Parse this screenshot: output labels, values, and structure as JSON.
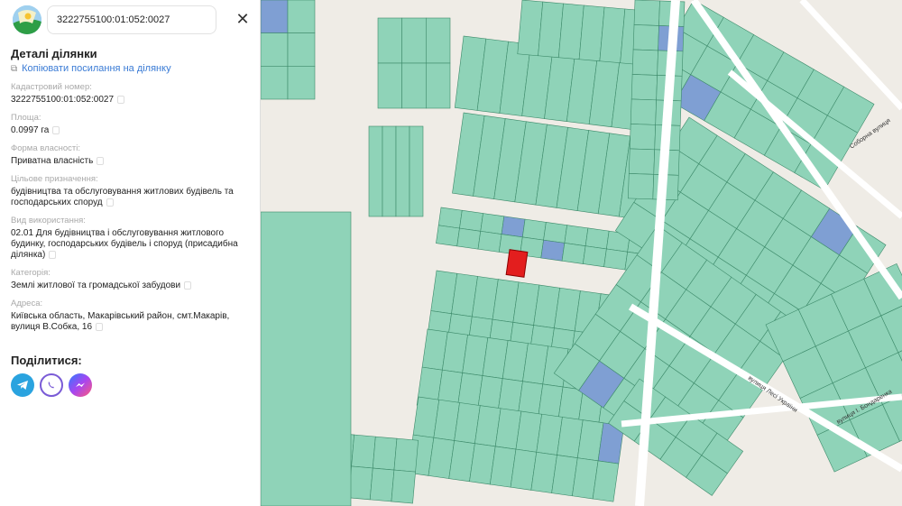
{
  "search": {
    "value": "3222755100:01:052:0027"
  },
  "panel": {
    "title": "Деталі ділянки",
    "copy_link": "Копіювати посилання на ділянку",
    "fields": [
      {
        "label": "Кадастровий номер:",
        "value": "3222755100:01:052:0027"
      },
      {
        "label": "Площа:",
        "value": "0.0997 га"
      },
      {
        "label": "Форма власності:",
        "value": "Приватна власність"
      },
      {
        "label": "Цільове призначення:",
        "value": "будівництва та обслуговування житлових будівель та господарських споруд"
      },
      {
        "label": "Вид використання:",
        "value": "02.01 Для будівництва і обслуговування житлового будинку, господарських будівель і споруд (присадибна ділянка)"
      },
      {
        "label": "Категорія:",
        "value": "Землі житлової та громадської забудови"
      },
      {
        "label": "Адреса:",
        "value": "Київська область, Макарівський район, смт.Макарів, вулиця В.Собка, 16"
      }
    ],
    "share_title": "Поділитися:",
    "share_icons": [
      "telegram-icon",
      "viber-icon",
      "messenger-icon"
    ]
  },
  "map": {
    "colors": {
      "parcel": "#8fd3b8",
      "parcel_stroke": "#3d8a6a",
      "state": "#7f9fd3",
      "selected": "#e31e1e",
      "road": "#ffffff",
      "bg": "#efece6"
    },
    "street_labels": [
      "Соборна вулиця",
      "вулиця Лесі України",
      "вулиця І. Бондаренка"
    ]
  }
}
